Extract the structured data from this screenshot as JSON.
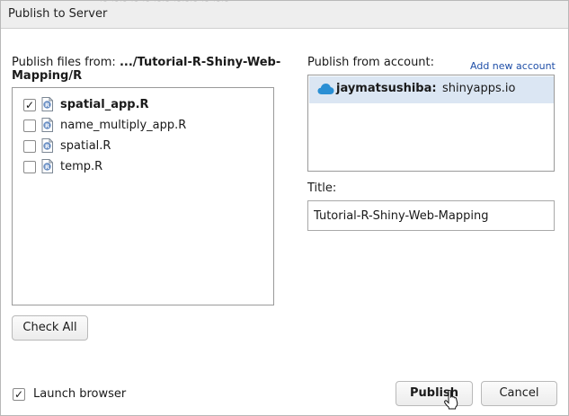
{
  "dialog": {
    "title": "Publish to Server",
    "title_overlap_text": "~ ~~ ~ ~ ~~ ~~~ ~ ~~"
  },
  "files": {
    "label_prefix": "Publish files from: ",
    "path": ".../Tutorial-R-Shiny-Web-Mapping/R",
    "items": [
      {
        "name": "spatial_app.R",
        "checked": true,
        "bold": true
      },
      {
        "name": "name_multiply_app.R",
        "checked": false,
        "bold": false
      },
      {
        "name": "spatial.R",
        "checked": false,
        "bold": false
      },
      {
        "name": "temp.R",
        "checked": false,
        "bold": false
      }
    ],
    "file_icon": "r-file-icon",
    "check_all_label": "Check All"
  },
  "account": {
    "label": "Publish from account:",
    "add_link": "Add new account",
    "items": [
      {
        "name": "jaymatsushiba:",
        "server": "shinyapps.io",
        "icon": "cloud-icon",
        "selected": true
      }
    ],
    "selected_bg": "#dbe6f3",
    "cloud_color": "#2a8fd4"
  },
  "title_field": {
    "label": "Title:",
    "value": "Tutorial-R-Shiny-Web-Mapping"
  },
  "options": {
    "launch_browser_label": "Launch browser",
    "launch_browser_checked": true
  },
  "actions": {
    "publish_label": "Publish",
    "cancel_label": "Cancel"
  },
  "checkmark": "✓"
}
